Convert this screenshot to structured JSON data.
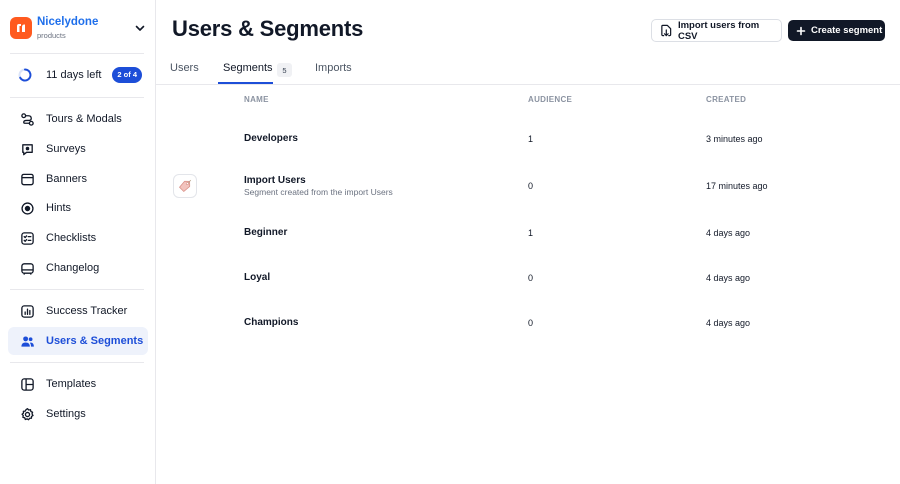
{
  "workspace": {
    "name": "Nicelydone",
    "subtitle": "products"
  },
  "trial": {
    "days_left": "11 days left",
    "badge": "2 of 4"
  },
  "sidebar": {
    "items": [
      {
        "label": "Tours & Modals",
        "icon": "tours-icon"
      },
      {
        "label": "Surveys",
        "icon": "surveys-icon"
      },
      {
        "label": "Banners",
        "icon": "banners-icon"
      },
      {
        "label": "Hints",
        "icon": "hints-icon"
      },
      {
        "label": "Checklists",
        "icon": "checklists-icon"
      },
      {
        "label": "Changelog",
        "icon": "changelog-icon"
      },
      {
        "label": "Success Tracker",
        "icon": "success-tracker-icon"
      },
      {
        "label": "Users & Segments",
        "icon": "users-icon",
        "active": true
      },
      {
        "label": "Templates",
        "icon": "templates-icon"
      },
      {
        "label": "Settings",
        "icon": "settings-icon"
      }
    ]
  },
  "header": {
    "title": "Users & Segments",
    "import_button": "Import users from CSV",
    "create_button": "Create segment"
  },
  "tabs": [
    {
      "label": "Users"
    },
    {
      "label": "Segments",
      "count": "5",
      "active": true
    },
    {
      "label": "Imports"
    }
  ],
  "table": {
    "columns": [
      "NAME",
      "AUDIENCE",
      "CREATED"
    ],
    "rows": [
      {
        "name": "Developers",
        "description": "",
        "audience": "1",
        "created": "3 minutes ago"
      },
      {
        "name": "Import Users",
        "description": "Segment created from the import Users",
        "audience": "0",
        "created": "17 minutes ago",
        "icon": "tag-icon"
      },
      {
        "name": "Beginner",
        "description": "",
        "audience": "1",
        "created": "4 days ago"
      },
      {
        "name": "Loyal",
        "description": "",
        "audience": "0",
        "created": "4 days ago"
      },
      {
        "name": "Champions",
        "description": "",
        "audience": "0",
        "created": "4 days ago"
      }
    ]
  },
  "colors": {
    "accent": "#1d4ed8",
    "brand_logo": "#ff5a1f",
    "primary_button": "#111827"
  }
}
